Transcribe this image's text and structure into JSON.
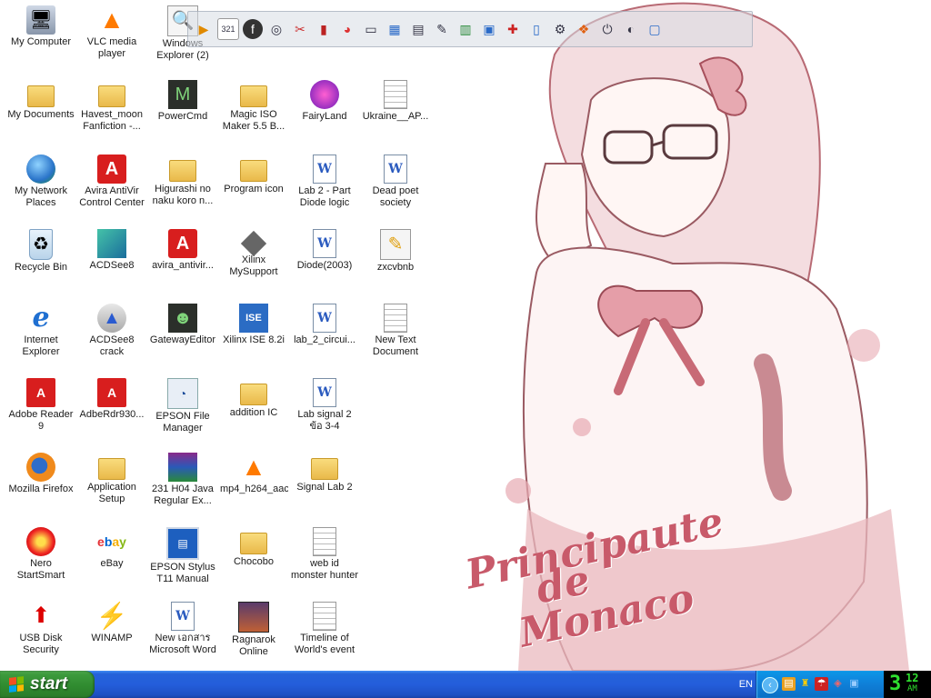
{
  "wallpaper": {
    "text_lines": [
      "Principaute",
      "de",
      "Monaco"
    ]
  },
  "icons": [
    {
      "label": "My Computer",
      "icon": "computer-icon"
    },
    {
      "label": "VLC media player",
      "icon": "vlc-cone-icon"
    },
    {
      "label": "Windows Explorer (2)",
      "icon": "explorer-icon"
    },
    {
      "label": "My Documents",
      "icon": "documents-folder-icon"
    },
    {
      "label": "Havest_moon Fanfiction -...",
      "icon": "folder-icon"
    },
    {
      "label": "PowerCmd",
      "icon": "powercmd-icon"
    },
    {
      "label": "Magic ISO Maker 5.5 B...",
      "icon": "folder-icon"
    },
    {
      "label": "FairyLand",
      "icon": "fairyland-icon"
    },
    {
      "label": "Ukraine__AP...",
      "icon": "file-icon"
    },
    {
      "label": "My Network Places",
      "icon": "network-globe-icon"
    },
    {
      "label": "Avira AntiVir Control Center",
      "icon": "avira-icon"
    },
    {
      "label": "Higurashi no naku koro n...",
      "icon": "folder-icon"
    },
    {
      "label": "Program icon",
      "icon": "folder-icon"
    },
    {
      "label": "Lab 2 - Part Diode logic",
      "icon": "word-doc-icon"
    },
    {
      "label": "Dead poet society",
      "icon": "word-doc-icon"
    },
    {
      "label": "Recycle Bin",
      "icon": "recycle-bin-icon"
    },
    {
      "label": "ACDSee8",
      "icon": "acdsee-icon"
    },
    {
      "label": "avira_antivir...",
      "icon": "avira-icon"
    },
    {
      "label": "Xilinx MySupport",
      "icon": "xilinx-chip-icon"
    },
    {
      "label": "Diode(2003)",
      "icon": "word-doc-icon"
    },
    {
      "label": "zxcvbnb",
      "icon": "paint-file-icon"
    },
    {
      "label": "Internet Explorer",
      "icon": "internet-explorer-icon"
    },
    {
      "label": "ACDSee8 crack",
      "icon": "acdsee-crack-icon"
    },
    {
      "label": "GatewayEditor",
      "icon": "gateway-editor-icon"
    },
    {
      "label": "Xilinx ISE 8.2i",
      "icon": "xilinx-ise-icon"
    },
    {
      "label": "lab_2_circui...",
      "icon": "word-doc-icon"
    },
    {
      "label": "New Text Document",
      "icon": "text-doc-icon"
    },
    {
      "label": "Adobe Reader 9",
      "icon": "adobe-reader-icon"
    },
    {
      "label": "AdbeRdr930...",
      "icon": "adobe-installer-icon"
    },
    {
      "label": "EPSON File Manager",
      "icon": "epson-file-manager-icon"
    },
    {
      "label": "addition IC",
      "icon": "folder-icon"
    },
    {
      "label": "Lab signal 2 ข้อ 3-4",
      "icon": "word-doc-icon"
    },
    {
      "label": "Mozilla Firefox",
      "icon": "firefox-icon"
    },
    {
      "label": "Application Setup",
      "icon": "folder-icon"
    },
    {
      "label": "231 H04 Java Regular Ex...",
      "icon": "winrar-icon"
    },
    {
      "label": "mp4_h264_aac",
      "icon": "vlc-cone-icon"
    },
    {
      "label": "Signal Lab 2",
      "icon": "folder-icon"
    },
    {
      "label": "Nero StartSmart",
      "icon": "nero-icon"
    },
    {
      "label": "eBay",
      "icon": "ebay-icon"
    },
    {
      "label": "EPSON Stylus T11 Manual",
      "icon": "epson-manual-icon"
    },
    {
      "label": "Chocobo",
      "icon": "folder-icon"
    },
    {
      "label": "web id monster hunter frontier",
      "icon": "text-doc-icon"
    },
    {
      "label": "USB Disk Security",
      "icon": "usb-security-icon"
    },
    {
      "label": "WINAMP",
      "icon": "winamp-icon"
    },
    {
      "label": "New เอกสาร Microsoft Word",
      "icon": "word-doc-icon"
    },
    {
      "label": "Ragnarok Online",
      "icon": "ragnarok-icon"
    },
    {
      "label": "Timeline of World's event",
      "icon": "text-doc-icon"
    }
  ],
  "quicklaunch": {
    "items": [
      "media-player-icon",
      "counter-icon",
      "flash-icon",
      "cd-icon",
      "tools-icon",
      "book-icon",
      "chart-icon",
      "scanner-icon",
      "folders-icon",
      "document-icon",
      "pencil-icon",
      "network-icon",
      "display-icon",
      "cable-icon",
      "window-icon",
      "gear-icon",
      "windows-icon",
      "power-icon",
      "moon-icon",
      "monitor-icon"
    ]
  },
  "taskbar": {
    "start_label": "start",
    "language": "EN",
    "clock_hour": "3",
    "clock_minute": "12",
    "clock_ampm": "AM"
  }
}
